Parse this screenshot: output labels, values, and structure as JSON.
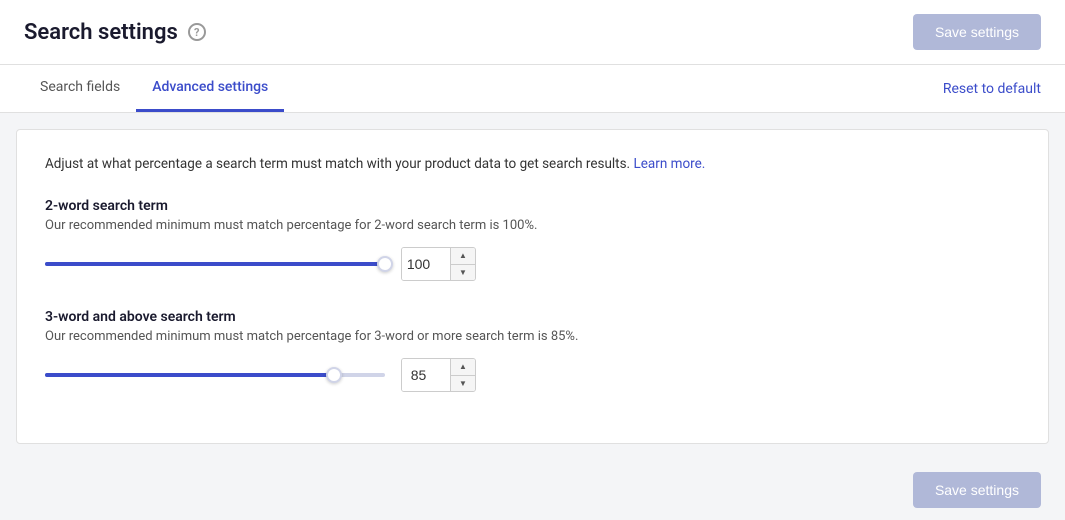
{
  "header": {
    "title": "Search settings",
    "help_icon_label": "?",
    "save_button_label": "Save settings"
  },
  "tabs": {
    "items": [
      {
        "id": "search-fields",
        "label": "Search fields",
        "active": false
      },
      {
        "id": "advanced-settings",
        "label": "Advanced settings",
        "active": true
      }
    ],
    "reset_label": "Reset to default"
  },
  "content": {
    "description": "Adjust at what percentage a search term must match with your product data to get search results.",
    "learn_more_label": "Learn more.",
    "two_word": {
      "title": "2-word search term",
      "description": "Our recommended minimum must match percentage for 2-word search term is 100%.",
      "value": 100,
      "fill_percent": 100
    },
    "three_word": {
      "title": "3-word and above search term",
      "description": "Our recommended minimum must match percentage for 3-word or more search term is 85%.",
      "value": 85,
      "fill_percent": 85
    }
  },
  "bottom": {
    "save_button_label": "Save settings"
  }
}
